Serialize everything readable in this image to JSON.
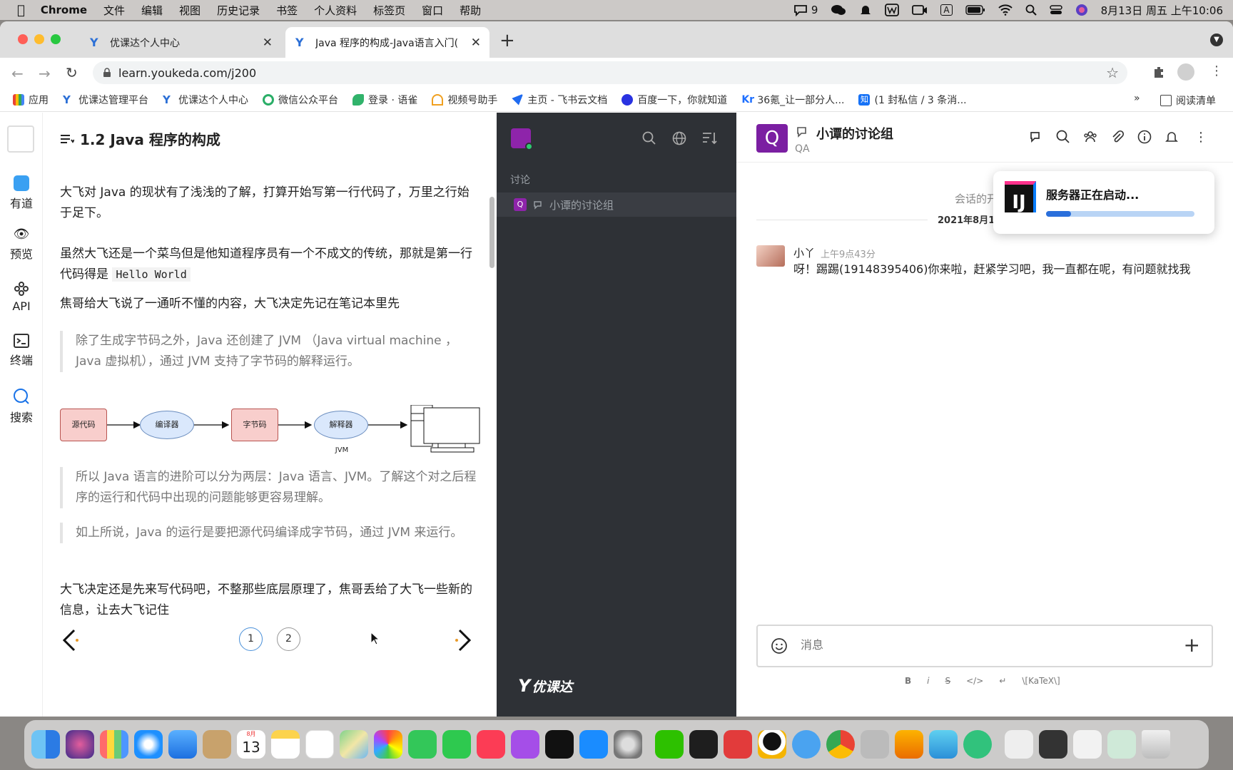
{
  "menubar": {
    "app": "Chrome",
    "items": [
      "文件",
      "编辑",
      "视图",
      "历史记录",
      "书签",
      "个人资料",
      "标签页",
      "窗口",
      "帮助"
    ],
    "notif_count": "9",
    "datetime": "8月13日 周五 上午10:06",
    "input_method": "A"
  },
  "browser": {
    "tabs": [
      {
        "title": "优课达个人中心"
      },
      {
        "title": "Java 程序的构成-Java语言入门("
      }
    ],
    "url": "learn.youkeda.com/j200",
    "bookmarks": [
      "应用",
      "优课达管理平台",
      "优课达个人中心",
      "微信公众平台",
      "登录 · 语雀",
      "视频号助手",
      "主页 - 飞书云文档",
      "百度一下，你就知道",
      "36氪_让一部分人...",
      "(1 封私信 / 3 条消..."
    ],
    "reading_list": "阅读清单",
    "more": "»"
  },
  "rail": {
    "items": [
      {
        "label": "有道"
      },
      {
        "label": "预览"
      },
      {
        "label": "API"
      },
      {
        "label": "终端"
      },
      {
        "label": "搜索"
      }
    ]
  },
  "article": {
    "title": "1.2 Java 程序的构成",
    "p1": "大飞对 Java 的现状有了浅浅的了解，打算开始写第一行代码了，万里之行始于足下。",
    "p2_text": "虽然大飞还是一个菜鸟但是他知道程序员有一个不成文的传统，那就是第一行代码得是",
    "p2_code": "Hello World",
    "p3": "焦哥给大飞说了一通听不懂的内容，大飞决定先记在笔记本里先",
    "quote1": "除了生成字节码之外，Java 还创建了 JVM （Java virtual machine ，Java 虚拟机），通过 JVM 支持了字节码的解释运行。",
    "quote2": "所以 Java 语言的进阶可以分为两层：Java 语言、JVM。了解这个对之后程序的运行和代码中出现的问题能够更容易理解。",
    "quote3": "如上所说，Java 的运行是要把源代码编译成字节码，通过 JVM 来运行。",
    "p4": "大飞决定还是先来写代码吧，不整那些底层原理了，焦哥丢给了大飞一些新的信息，让去大飞记住",
    "diagram": {
      "source": "源代码",
      "compiler": "编译器",
      "bytecode": "字节码",
      "interpreter": "解释器",
      "jvm": "JVM"
    },
    "pages": [
      "1",
      "2"
    ]
  },
  "darkpanel": {
    "section": "讨论",
    "channel": "小谭的讨论组",
    "channel_avatar": "Q",
    "brand": "优课达"
  },
  "chat": {
    "avatar": "Q",
    "title": "小谭的讨论组",
    "subtitle": "QA",
    "session_start": "会话的开",
    "date": "2021年8月13日",
    "message": {
      "user": "小丫",
      "time": "上午9点43分",
      "text": "呀！踢踢(19148395406)你来啦，赶紧学习吧，我一直都在呢，有问题就找我"
    },
    "input_placeholder": "消息",
    "format_bar": [
      "B",
      "i",
      "S",
      "</>",
      "↵",
      "\\[KaTeX\\]"
    ]
  },
  "notification": {
    "logo": "IJ",
    "text": "服务器正在启动...",
    "progress": 0.15
  },
  "dock": {
    "calendar_month": "8月",
    "calendar_day": "13"
  },
  "colors": {
    "purple": "#7b1fa2",
    "dark": "#2e3136",
    "accent_green": "#2ecc71"
  }
}
